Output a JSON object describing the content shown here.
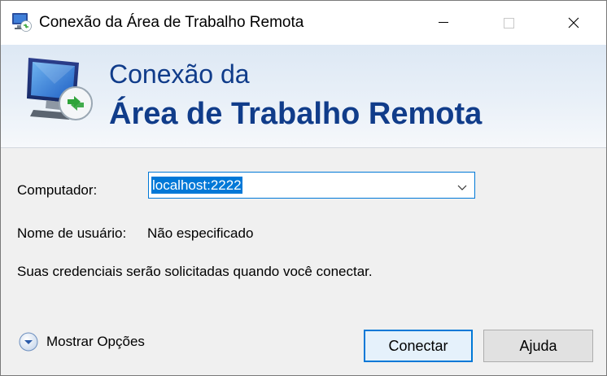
{
  "window": {
    "title": "Conexão da Área de Trabalho Remota",
    "icon": "remote-desktop-icon",
    "controls": [
      "minimize-icon",
      "maximize-icon",
      "close-icon"
    ]
  },
  "banner": {
    "line1": "Conexão da",
    "line2": "Área de Trabalho Remota",
    "logo": "remote-desktop-monitor-icon",
    "title_color": "#103c8a"
  },
  "form": {
    "computer_label": "Computador:",
    "computer_value": "localhost:2222",
    "username_label": "Nome de usuário:",
    "username_value": "Não especificado",
    "credentials_note": "Suas credenciais serão solicitadas quando você conectar."
  },
  "footer": {
    "show_options": "Mostrar Opções",
    "connect_button": "Conectar",
    "help_button": "Ajuda"
  },
  "colors": {
    "accent": "#0078d7",
    "window_bg": "#f0f0f0"
  }
}
